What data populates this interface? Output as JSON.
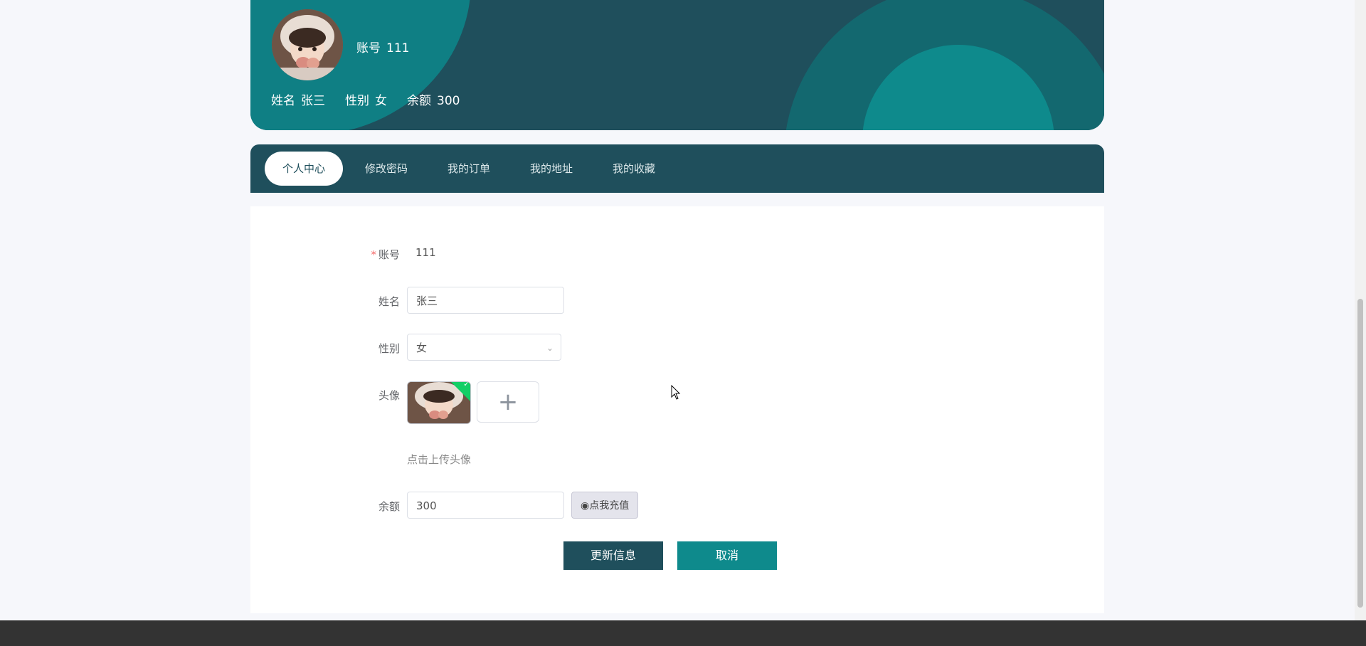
{
  "profile_card": {
    "account_label": "账号",
    "account_value": "111",
    "name_label": "姓名",
    "name_value": "张三",
    "gender_label": "性别",
    "gender_value": "女",
    "balance_label": "余额",
    "balance_value": "300"
  },
  "tabs": [
    {
      "label": "个人中心",
      "active": true
    },
    {
      "label": "修改密码",
      "active": false
    },
    {
      "label": "我的订单",
      "active": false
    },
    {
      "label": "我的地址",
      "active": false
    },
    {
      "label": "我的收藏",
      "active": false
    }
  ],
  "form": {
    "account_label": "账号",
    "account_value": "111",
    "name_label": "姓名",
    "name_value": "张三",
    "gender_label": "性别",
    "gender_value": "女",
    "avatar_label": "头像",
    "upload_hint": "点击上传头像",
    "balance_label": "余额",
    "balance_value": "300",
    "recharge_label": "点我充值",
    "update_button": "更新信息",
    "cancel_button": "取消"
  },
  "colors": {
    "primary_dark": "#1f4f5c",
    "teal": "#0e8a8c",
    "required": "#f56c6c",
    "success": "#13ce66"
  }
}
